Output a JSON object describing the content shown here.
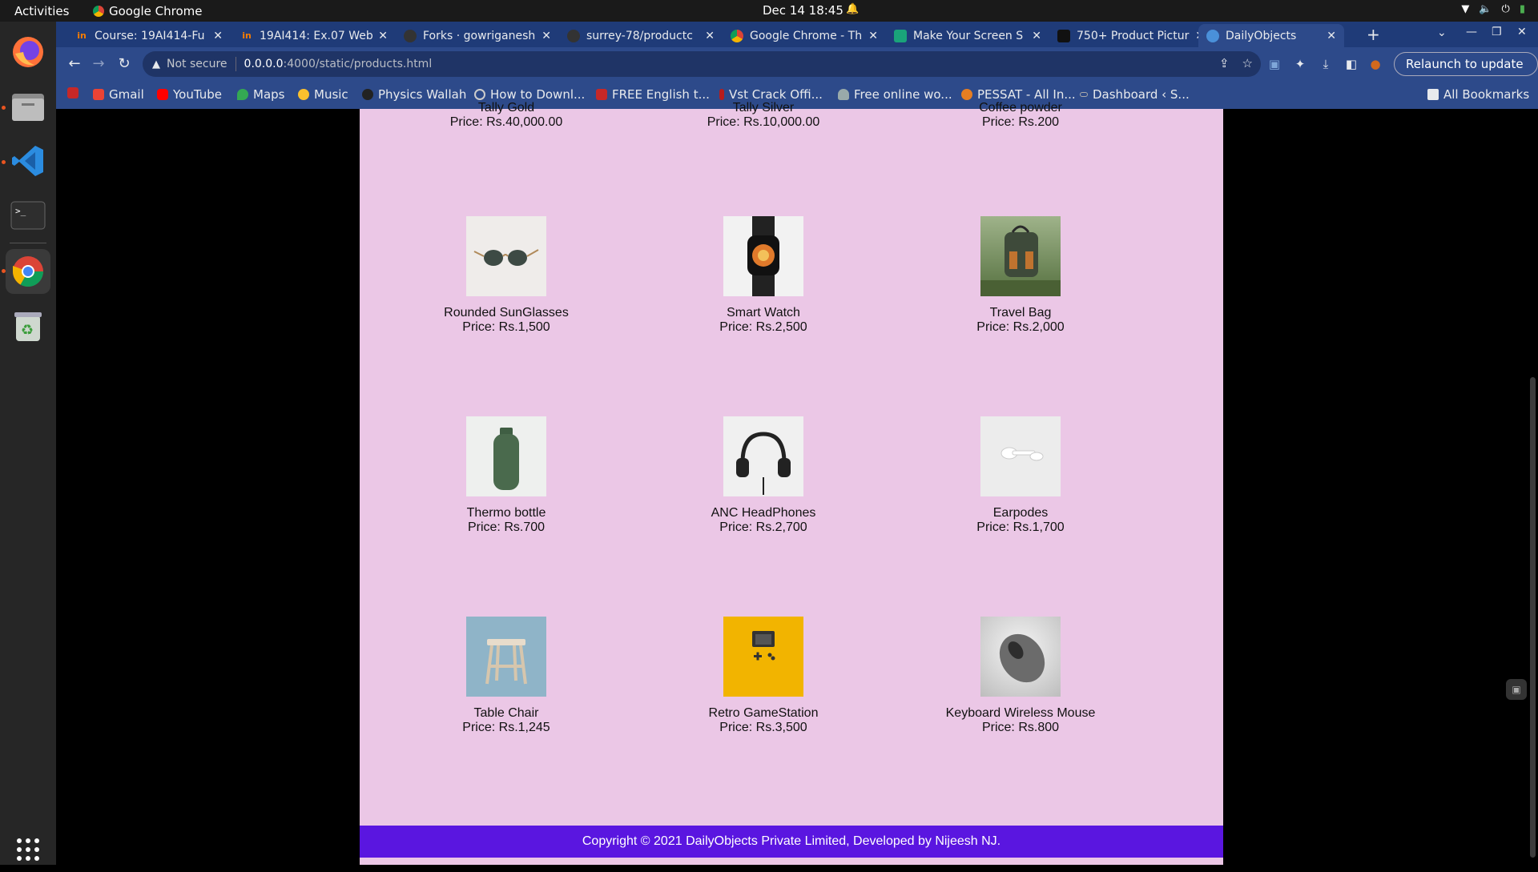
{
  "topbar": {
    "activities": "Activities",
    "app_name": "Google Chrome",
    "clock": "Dec 14  18:45"
  },
  "tabs": [
    {
      "title": "Course: 19AI414-Fu",
      "icon": "nptel-icon"
    },
    {
      "title": "19AI414: Ex.07 Web",
      "icon": "nptel-icon"
    },
    {
      "title": "Forks · gowriganesh",
      "icon": "github-icon"
    },
    {
      "title": "surrey-78/productc",
      "icon": "github-icon"
    },
    {
      "title": "Google Chrome - Th",
      "icon": "chrome-icon"
    },
    {
      "title": "Make Your Screen S",
      "icon": "docs-icon"
    },
    {
      "title": "750+ Product Pictur",
      "icon": "unsplash-icon"
    },
    {
      "title": "DailyObjects",
      "icon": "globe-icon"
    }
  ],
  "address": {
    "security": "Not secure",
    "host": "0.0.0.0",
    "rest": ":4000/static/products.html"
  },
  "relaunch_label": "Relaunch to update",
  "bookmarks": [
    {
      "label": "",
      "icon": "mailchimp-icon"
    },
    {
      "label": "Gmail",
      "icon": "gmail-icon"
    },
    {
      "label": "YouTube",
      "icon": "youtube-icon"
    },
    {
      "label": "Maps",
      "icon": "maps-icon"
    },
    {
      "label": "Music",
      "icon": "music-icon"
    },
    {
      "label": "Physics Wallah",
      "icon": "pw-icon"
    },
    {
      "label": "How to Downl...",
      "icon": "globe-icon"
    },
    {
      "label": "FREE English t...",
      "icon": "book-icon"
    },
    {
      "label": "Vst Crack Offi...",
      "icon": "vst-icon"
    },
    {
      "label": "Free online wo...",
      "icon": "cloud-icon"
    },
    {
      "label": "PESSAT - All In...",
      "icon": "pessat-icon"
    },
    {
      "label": "Dashboard ‹ S...",
      "icon": "wp-icon"
    },
    {
      "label": "All Bookmarks",
      "icon": "folder-icon"
    }
  ],
  "products_top_row": [
    {
      "name": "Tally Gold",
      "price": "Price: Rs.40,000.00"
    },
    {
      "name": "Tally Silver",
      "price": "Price: Rs.10,000.00"
    },
    {
      "name": "Coffee powder",
      "price": "Price: Rs.200"
    }
  ],
  "products": [
    {
      "name": "Rounded SunGlasses",
      "price": "Price: Rs.1,500",
      "image": "sunglasses-image",
      "bg": "#efecea"
    },
    {
      "name": "Smart Watch",
      "price": "Price: Rs.2,500",
      "image": "smartwatch-image",
      "bg": "#f2f2f2"
    },
    {
      "name": "Travel Bag",
      "price": "Price: Rs.2,000",
      "image": "travel-bag-image",
      "bg": "#6f8a5a"
    },
    {
      "name": "Thermo bottle",
      "price": "Price: Rs.700",
      "image": "thermo-bottle-image",
      "bg": "#eef0ee"
    },
    {
      "name": "ANC HeadPhones",
      "price": "Price: Rs.2,700",
      "image": "headphones-image",
      "bg": "#f0f0f0"
    },
    {
      "name": "Earpodes",
      "price": "Price: Rs.1,700",
      "image": "earpods-image",
      "bg": "#ececec"
    },
    {
      "name": "Table Chair",
      "price": "Price: Rs.1,245",
      "image": "stool-image",
      "bg": "#8fb4c8"
    },
    {
      "name": "Retro GameStation",
      "price": "Price: Rs.3,500",
      "image": "gameboy-image",
      "bg": "#f2b400"
    },
    {
      "name": "Keyboard Wireless Mouse",
      "price": "Price: Rs.800",
      "image": "mouse-image",
      "bg": "#dcdcdc"
    }
  ],
  "footer": "Copyright © 2021 DailyObjects Private Limited, Developed by Nijeesh NJ.",
  "colors": {
    "page_bg": "#ebc7e6",
    "footer_bg": "#5a16e0",
    "chrome_frame": "#1f3b78"
  }
}
